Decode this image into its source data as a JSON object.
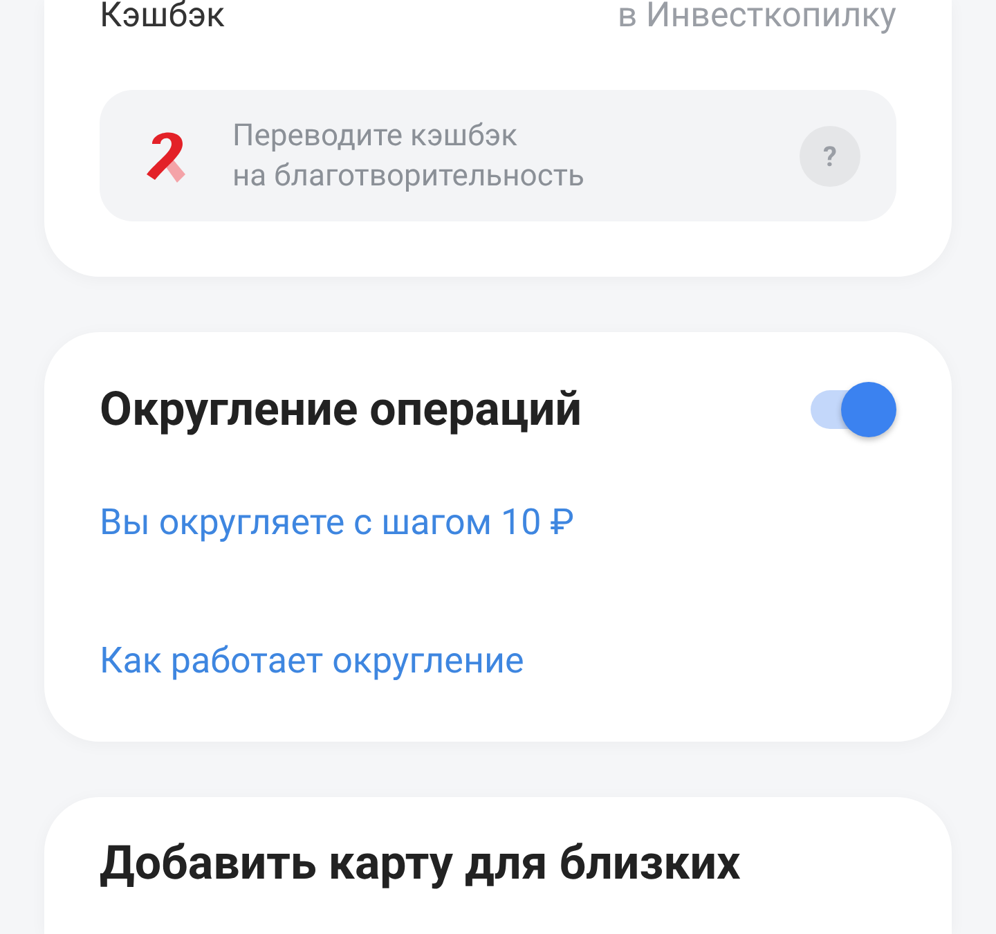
{
  "cashback_card": {
    "label": "Кэшбэк",
    "value": "в Инвесткопилку",
    "charity": {
      "text": "Переводите кэшбэк\nна благотворительность",
      "help": "?"
    }
  },
  "rounding_card": {
    "title": "Округление операций",
    "on": true,
    "links": [
      "Вы округляете с шагом 10 ₽",
      "Как работает округление"
    ]
  },
  "family_card": {
    "title": "Добавить карту для близких"
  }
}
